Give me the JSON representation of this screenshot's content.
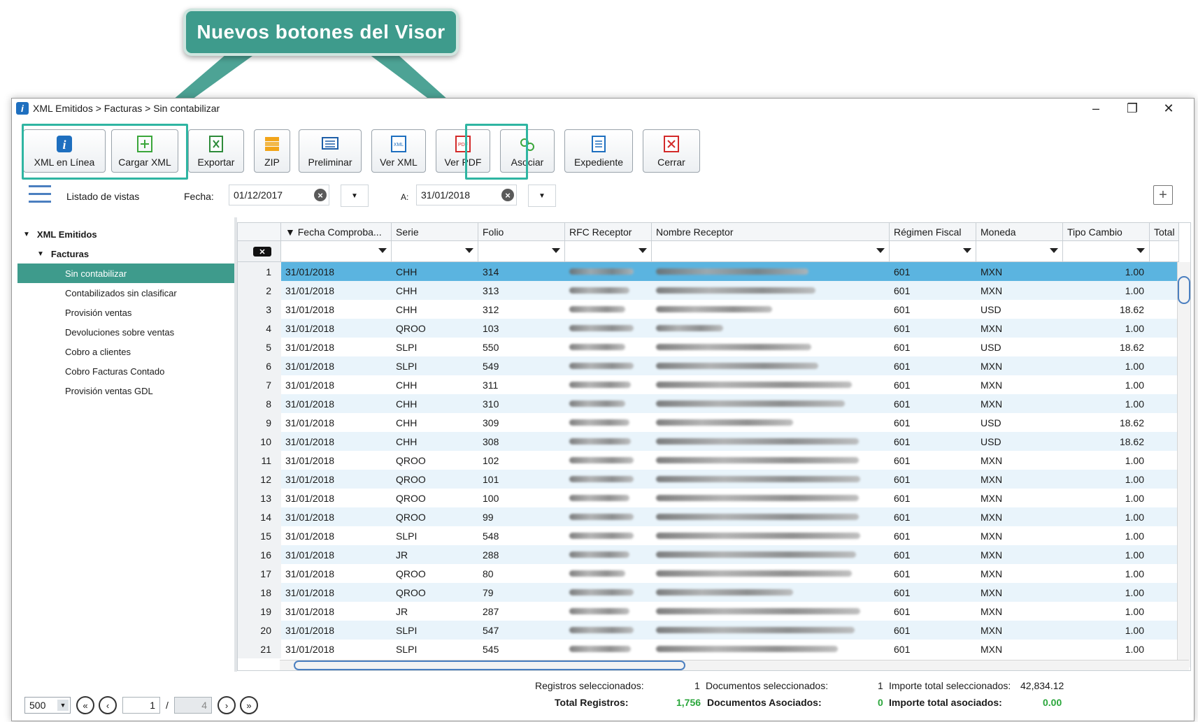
{
  "callout": {
    "text": "Nuevos botones del Visor"
  },
  "window": {
    "title": "XML Emitidos > Facturas > Sin contabilizar",
    "minimize": "–",
    "restore": "❐",
    "close": "✕"
  },
  "toolbar": {
    "buttons": [
      {
        "label": "XML en Línea",
        "icon": "info-icon"
      },
      {
        "label": "Cargar XML",
        "icon": "plus-icon"
      },
      {
        "label": "Exportar",
        "icon": "excel-icon"
      },
      {
        "label": "ZIP",
        "icon": "zip-icon"
      },
      {
        "label": "Preliminar",
        "icon": "preview-icon"
      },
      {
        "label": "Ver XML",
        "icon": "xml-icon"
      },
      {
        "label": "Ver PDF",
        "icon": "pdf-icon"
      },
      {
        "label": "Asociar",
        "icon": "link-icon"
      },
      {
        "label": "Expediente",
        "icon": "file-icon"
      },
      {
        "label": "Cerrar",
        "icon": "close-icon"
      }
    ]
  },
  "filters": {
    "views_label": "Listado de vistas",
    "fecha_label": "Fecha:",
    "fecha_from": "01/12/2017",
    "a_label": "A:",
    "fecha_to": "31/01/2018"
  },
  "sidebar": {
    "root": "XML Emitidos",
    "group": "Facturas",
    "items": [
      "Sin contabilizar",
      "Contabilizados sin clasificar",
      "Provisión ventas",
      "Devoluciones sobre ventas",
      "Cobro a clientes",
      "Cobro Facturas Contado",
      "Provisión ventas GDL"
    ]
  },
  "table": {
    "columns": [
      "▼ Fecha Comproba...",
      "Serie",
      "Folio",
      "RFC Receptor",
      "Nombre Receptor",
      "Régimen Fiscal",
      "Moneda",
      "Tipo Cambio",
      "Total"
    ],
    "rows": [
      [
        "1",
        "31/01/2018",
        "CHH",
        "314",
        "601",
        "MXN",
        "1.00"
      ],
      [
        "2",
        "31/01/2018",
        "CHH",
        "313",
        "601",
        "MXN",
        "1.00"
      ],
      [
        "3",
        "31/01/2018",
        "CHH",
        "312",
        "601",
        "USD",
        "18.62"
      ],
      [
        "4",
        "31/01/2018",
        "QROO",
        "103",
        "601",
        "MXN",
        "1.00"
      ],
      [
        "5",
        "31/01/2018",
        "SLPI",
        "550",
        "601",
        "USD",
        "18.62"
      ],
      [
        "6",
        "31/01/2018",
        "SLPI",
        "549",
        "601",
        "MXN",
        "1.00"
      ],
      [
        "7",
        "31/01/2018",
        "CHH",
        "311",
        "601",
        "MXN",
        "1.00"
      ],
      [
        "8",
        "31/01/2018",
        "CHH",
        "310",
        "601",
        "MXN",
        "1.00"
      ],
      [
        "9",
        "31/01/2018",
        "CHH",
        "309",
        "601",
        "USD",
        "18.62"
      ],
      [
        "10",
        "31/01/2018",
        "CHH",
        "308",
        "601",
        "USD",
        "18.62"
      ],
      [
        "11",
        "31/01/2018",
        "QROO",
        "102",
        "601",
        "MXN",
        "1.00"
      ],
      [
        "12",
        "31/01/2018",
        "QROO",
        "101",
        "601",
        "MXN",
        "1.00"
      ],
      [
        "13",
        "31/01/2018",
        "QROO",
        "100",
        "601",
        "MXN",
        "1.00"
      ],
      [
        "14",
        "31/01/2018",
        "QROO",
        "99",
        "601",
        "MXN",
        "1.00"
      ],
      [
        "15",
        "31/01/2018",
        "SLPI",
        "548",
        "601",
        "MXN",
        "1.00"
      ],
      [
        "16",
        "31/01/2018",
        "JR",
        "288",
        "601",
        "MXN",
        "1.00"
      ],
      [
        "17",
        "31/01/2018",
        "QROO",
        "80",
        "601",
        "MXN",
        "1.00"
      ],
      [
        "18",
        "31/01/2018",
        "QROO",
        "79",
        "601",
        "MXN",
        "1.00"
      ],
      [
        "19",
        "31/01/2018",
        "JR",
        "287",
        "601",
        "MXN",
        "1.00"
      ],
      [
        "20",
        "31/01/2018",
        "SLPI",
        "547",
        "601",
        "MXN",
        "1.00"
      ],
      [
        "21",
        "31/01/2018",
        "SLPI",
        "545",
        "601",
        "MXN",
        "1.00"
      ]
    ]
  },
  "footer": {
    "page_size": "500",
    "page": "1",
    "sep": "/",
    "pages": "4",
    "reg_sel_label": "Registros seleccionados:",
    "reg_sel_value": "1",
    "doc_sel_label": "Documentos seleccionados:",
    "doc_sel_value": "1",
    "imp_sel_label": "Importe total seleccionados:",
    "imp_sel_value": "42,834.12",
    "total_reg_label": "Total Registros:",
    "total_reg_value": "1,756",
    "doc_asoc_label": "Documentos Asociados:",
    "doc_asoc_value": "0",
    "imp_asoc_label": "Importe total asociados:",
    "imp_asoc_value": "0.00"
  },
  "colors": {
    "accent": "#3e9b8c",
    "highlight": "#2fb5a2",
    "selected_row": "#5bb4e0"
  }
}
